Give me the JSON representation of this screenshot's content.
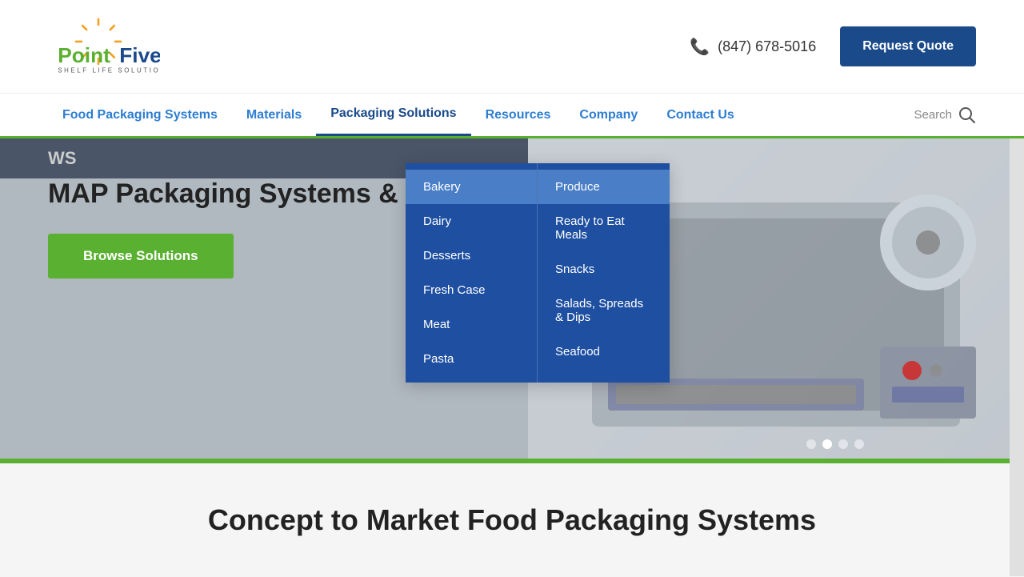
{
  "header": {
    "logo_alt": "PointFive Shelf Life Solutions",
    "phone": "(847) 678-5016",
    "request_quote_label": "Request Quote"
  },
  "nav": {
    "items": [
      {
        "label": "Food Packaging Systems",
        "id": "food-packaging"
      },
      {
        "label": "Materials",
        "id": "materials"
      },
      {
        "label": "Packaging Solutions",
        "id": "packaging-solutions"
      },
      {
        "label": "Resources",
        "id": "resources"
      },
      {
        "label": "Company",
        "id": "company"
      },
      {
        "label": "Contact Us",
        "id": "contact-us"
      }
    ],
    "search_placeholder": "Search"
  },
  "dropdown": {
    "col1": [
      {
        "label": "Bakery"
      },
      {
        "label": "Dairy"
      },
      {
        "label": "Desserts"
      },
      {
        "label": "Fresh Case"
      },
      {
        "label": "Meat"
      },
      {
        "label": "Pasta"
      }
    ],
    "col2": [
      {
        "label": "Produce"
      },
      {
        "label": "Ready to Eat Meals"
      },
      {
        "label": "Snacks"
      },
      {
        "label": "Salads, Spreads & Dips"
      },
      {
        "label": "Seafood"
      }
    ]
  },
  "hero": {
    "title": "MAP Packaging Systems & Materi",
    "browse_label": "Browse Solutions",
    "banner_text": "WS"
  },
  "bottom": {
    "title": "Concept to Market Food Packaging Systems"
  }
}
